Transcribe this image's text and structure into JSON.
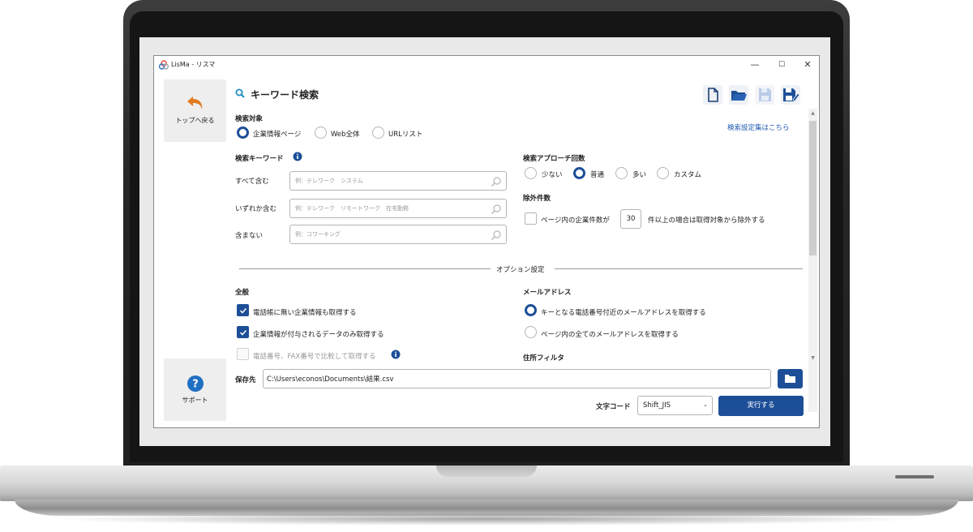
{
  "window": {
    "title": "LisMa - リスマ",
    "minimize": "—",
    "maximize": "☐",
    "close": "✕"
  },
  "nav": {
    "back_label": "トップへ戻る",
    "support_label": "サポート"
  },
  "page": {
    "title": "キーワード検索",
    "settings_link": "検索設定集はこちら"
  },
  "search_target": {
    "heading": "検索対象",
    "options": [
      "企業情報ページ",
      "Web全体",
      "URLリスト"
    ],
    "selected": "企業情報ページ"
  },
  "keywords": {
    "heading": "検索キーワード",
    "rows": [
      {
        "label": "すべて含む",
        "placeholder": "例：テレワーク　システム"
      },
      {
        "label": "いずれか含む",
        "placeholder": "例：テレワーク　リモートワーク　在宅勤務"
      },
      {
        "label": "含まない",
        "placeholder": "例：コワーキング"
      }
    ]
  },
  "approach": {
    "heading": "検索アプローチ回数",
    "options": [
      "少ない",
      "普通",
      "多い",
      "カスタム"
    ],
    "selected": "普通"
  },
  "exclusion": {
    "heading": "除外件数",
    "prefix": "ページ内の企業件数が",
    "value": "30",
    "suffix": "件以上の場合は取得対象から除外する",
    "checked": false
  },
  "options_divider": "オプション設定",
  "general": {
    "heading": "全般",
    "items": [
      {
        "label": "電話帳に無い企業情報も取得する",
        "checked": true,
        "disabled": false
      },
      {
        "label": "企業情報が付与されるデータのみ取得する",
        "checked": true,
        "disabled": false
      },
      {
        "label": "電話番号、FAX番号で比較して取得する",
        "checked": false,
        "disabled": true
      }
    ]
  },
  "email": {
    "heading": "メールアドレス",
    "options": [
      "キーとなる電話番号付近のメールアドレスを取得する",
      "ページ内の全てのメールアドレスを取得する"
    ],
    "selected": "キーとなる電話番号付近のメールアドレスを取得する"
  },
  "address_filter": {
    "heading": "住所フィルタ"
  },
  "save": {
    "label": "保存先",
    "path": "C:\\Users\\econos\\Documents\\結果.csv"
  },
  "encoding": {
    "label": "文字コード",
    "value": "Shift_JIS"
  },
  "run_button": "実行する",
  "colors": {
    "accent": "#1d4f98",
    "link": "#1f5bb0",
    "back_arrow": "#e07a1f",
    "help": "#1f6fc2"
  }
}
